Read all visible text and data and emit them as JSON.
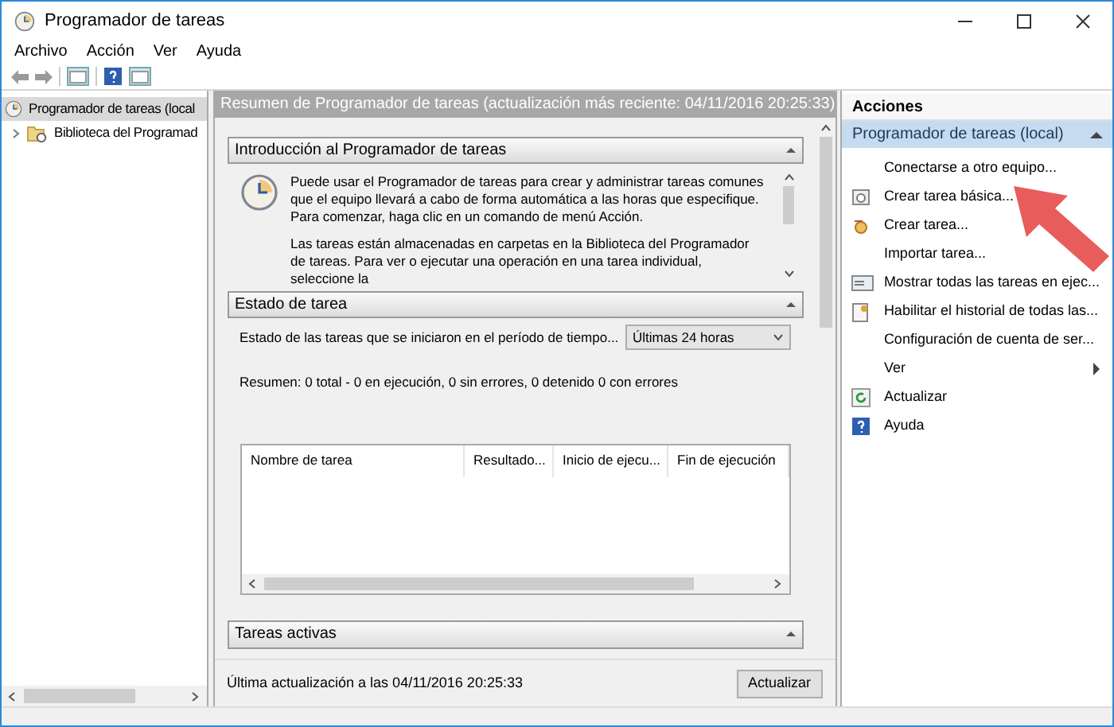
{
  "window": {
    "title": "Programador de tareas"
  },
  "menu": [
    "Archivo",
    "Acción",
    "Ver",
    "Ayuda"
  ],
  "tree": [
    {
      "label": "Programador de tareas (local",
      "selected": true,
      "children": [
        {
          "label": "Biblioteca del Programad",
          "selected": false,
          "expanded": false
        }
      ]
    }
  ],
  "summary": {
    "title": "Resumen de Programador de tareas (actualización más reciente: 04/11/2016 20:25:33)",
    "intro": {
      "title": "Introducción al Programador de tareas",
      "paragraphs": [
        "Puede usar el Programador de tareas para crear y administrar tareas comunes que el equipo llevará a cabo de forma automática a las horas que especifique. Para comenzar, haga clic en un comando de menú Acción.",
        "Las tareas están almacenadas en carpetas en la Biblioteca del Programador de tareas. Para ver o ejecutar una operación en una tarea individual, seleccione la"
      ]
    },
    "status": {
      "title": "Estado de tarea",
      "period_label": "Estado de las tareas que se iniciaron en el período de tiempo...",
      "period_value": "Últimas 24 horas",
      "summary": "Resumen: 0 total - 0 en ejecución, 0 sin errores, 0 detenido  0 con errores",
      "columns": [
        "Nombre de tarea",
        "Resultado...",
        "Inicio de ejecu...",
        "Fin de ejecución"
      ]
    },
    "active": {
      "title": "Tareas activas"
    },
    "last_update": "Última actualización a las 04/11/2016 20:25:33",
    "refresh_button": "Actualizar"
  },
  "actions": {
    "title": "Acciones",
    "group": "Programador de tareas (local)",
    "items": [
      {
        "label": "Conectarse a otro equipo...",
        "kind": "plain"
      },
      {
        "label": "Crear tarea básica...",
        "kind": "wizard"
      },
      {
        "label": "Crear tarea...",
        "kind": "task"
      },
      {
        "label": "Importar tarea...",
        "kind": "plain"
      },
      {
        "label": "Mostrar todas las tareas en ejec...",
        "kind": "list"
      },
      {
        "label": "Habilitar el historial de todas las...",
        "kind": "history"
      },
      {
        "label": "Configuración de cuenta de ser...",
        "kind": "plain"
      },
      {
        "label": "Ver",
        "kind": "submenu"
      },
      {
        "label": "Actualizar",
        "kind": "refresh"
      },
      {
        "label": "Ayuda",
        "kind": "help"
      }
    ]
  }
}
